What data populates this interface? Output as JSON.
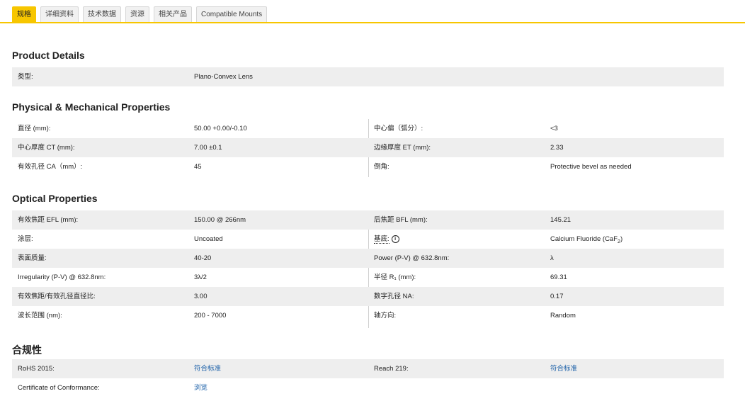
{
  "tabs": [
    {
      "label": "规格",
      "active": true
    },
    {
      "label": "详细资料",
      "active": false
    },
    {
      "label": "技术数据",
      "active": false
    },
    {
      "label": "资源",
      "active": false
    },
    {
      "label": "相关产品",
      "active": false
    },
    {
      "label": "Compatible Mounts",
      "active": false
    }
  ],
  "product_details": {
    "title": "Product Details",
    "type_label": "类型:",
    "type_value": "Plano-Convex Lens"
  },
  "physical": {
    "title": "Physical & Mechanical Properties",
    "rows": [
      {
        "l1": "直径 (mm):",
        "v1": "50.00 +0.00/-0.10",
        "l2": "中心偏（弧分）:",
        "v2": "<3"
      },
      {
        "l1": "中心厚度 CT (mm):",
        "v1": "7.00 ±0.1",
        "l2": "边缘厚度 ET (mm):",
        "v2": "2.33"
      },
      {
        "l1": "有效孔径 CA（mm）:",
        "v1": "45",
        "l2": "倒角:",
        "v2": "Protective bevel as needed"
      }
    ]
  },
  "optical": {
    "title": "Optical Properties",
    "rows": [
      {
        "l1": "有效焦距 EFL (mm):",
        "v1": "150.00 @ 266nm",
        "l2": "后焦距 BFL (mm):",
        "v2": "145.21"
      },
      {
        "l1": "涂层:",
        "v1": "Uncoated",
        "l2": "基底:",
        "v2": "Calcium Fluoride (CaF",
        "v2_sub": "2",
        "v2_end": ")"
      },
      {
        "l1": "表面质量:",
        "v1": "40-20",
        "l2": "Power (P-V) @ 632.8nm:",
        "v2": "λ"
      },
      {
        "l1": "Irregularity (P-V) @ 632.8nm:",
        "v1": "3λ/2",
        "l2": "半径 R₁ (mm):",
        "v2": "69.31"
      },
      {
        "l1": "有效焦距/有效孔径直径比:",
        "v1": "3.00",
        "l2": "数字孔径 NA:",
        "v2": "0.17"
      },
      {
        "l1": "波长范围 (nm):",
        "v1": "200 - 7000",
        "l2": "轴方向:",
        "v2": "Random"
      }
    ]
  },
  "compliance": {
    "title": "合规性",
    "rows": [
      {
        "l1": "RoHS 2015:",
        "v1": "符合标准",
        "l2": "Reach 219:",
        "v2": "符合标准"
      },
      {
        "l1": "Certificate of Conformance:",
        "v1": "浏览"
      }
    ]
  },
  "icons": {
    "info": "info-icon"
  },
  "colors": {
    "accent": "#f7c600",
    "link": "#1a5fa8",
    "row_shade": "#eeeeee"
  }
}
